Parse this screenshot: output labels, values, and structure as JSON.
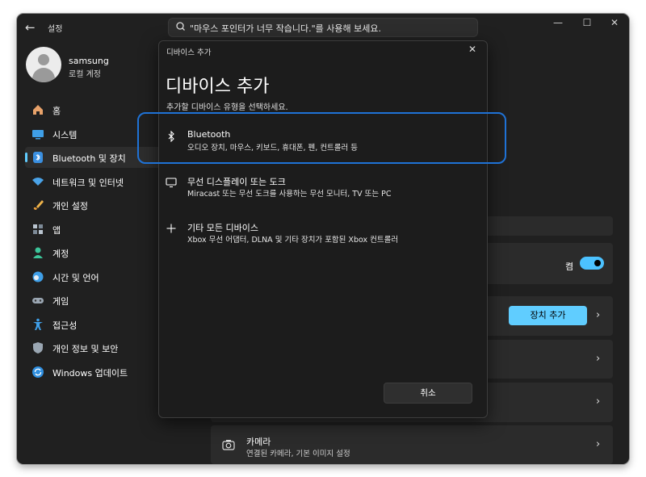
{
  "window": {
    "back_icon": "back-arrow-icon",
    "app_title": "설정",
    "search": {
      "value": "\"마우스 포인터가 너무 작습니다.\"를 사용해 보세요.",
      "icon": "search-icon"
    },
    "controls": {
      "minimize": "—",
      "maximize": "☐",
      "close": "✕"
    }
  },
  "user": {
    "name": "samsung",
    "account": "로컬 계정"
  },
  "sidebar": {
    "items": [
      {
        "label": "홈",
        "icon": "home-icon"
      },
      {
        "label": "시스템",
        "icon": "system-icon"
      },
      {
        "label": "Bluetooth 및 장치",
        "icon": "bluetooth-icon",
        "selected": true
      },
      {
        "label": "네트워크 및 인터넷",
        "icon": "network-icon"
      },
      {
        "label": "개인 설정",
        "icon": "brush-icon"
      },
      {
        "label": "앱",
        "icon": "apps-icon"
      },
      {
        "label": "계정",
        "icon": "account-icon"
      },
      {
        "label": "시간 및 언어",
        "icon": "time-language-icon"
      },
      {
        "label": "게임",
        "icon": "gaming-icon"
      },
      {
        "label": "접근성",
        "icon": "accessibility-icon"
      },
      {
        "label": "개인 정보 및 보안",
        "icon": "shield-icon"
      },
      {
        "label": "Windows 업데이트",
        "icon": "update-icon"
      }
    ]
  },
  "main": {
    "toggle_label": "켬",
    "add_device_label": "장치 추가",
    "camera": {
      "title": "카메라",
      "subtitle": "연결된 카메라, 기본 이미지 설정"
    }
  },
  "dialog": {
    "bar_title": "디바이스 추가",
    "heading": "디바이스 추가",
    "description": "추가할 디바이스 유형을 선택하세요.",
    "options": [
      {
        "title": "Bluetooth",
        "subtitle": "오디오 장치, 마우스, 키보드, 휴대폰, 펜, 컨트롤러 등",
        "icon": "bluetooth-icon"
      },
      {
        "title": "무선 디스플레이 또는 도크",
        "subtitle": "Miracast 또는 무선 도크를 사용하는 무선 모니터, TV 또는 PC",
        "icon": "monitor-icon"
      },
      {
        "title": "기타 모든 디바이스",
        "subtitle": "Xbox 무선 어댑터, DLNA 및 기타 장치가 포함된 Xbox 컨트롤러",
        "icon": "plus-icon"
      }
    ],
    "cancel_label": "취소"
  },
  "colors": {
    "accent": "#60cdff",
    "highlight_border": "#1f72d6",
    "background": "#202020"
  }
}
